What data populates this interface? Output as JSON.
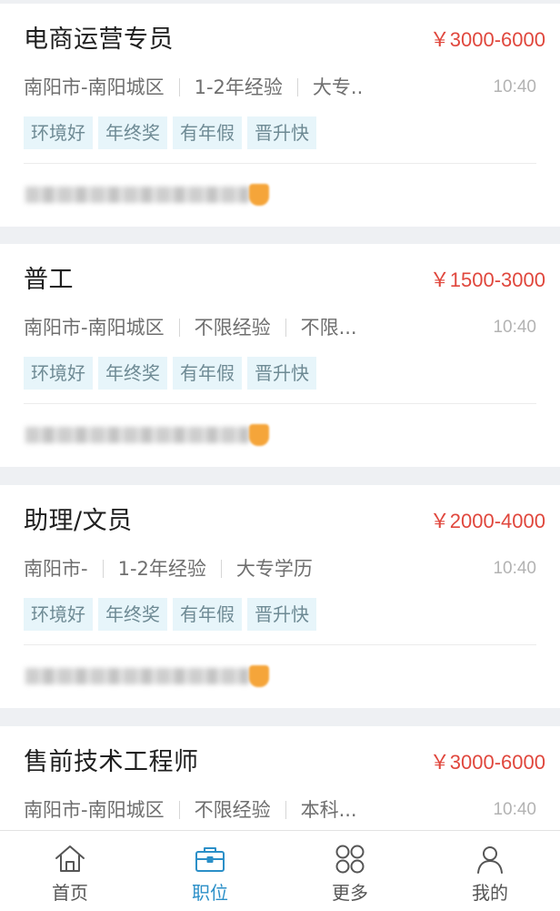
{
  "jobs": [
    {
      "title": "电商运营专员",
      "salary": "￥3000-6000",
      "location": "南阳市-南阳城区",
      "experience": "1-2年经验",
      "education": "大专..",
      "time": "10:40",
      "tags": [
        "环境好",
        "年终奖",
        "有年假",
        "晋升快"
      ]
    },
    {
      "title": "普工",
      "salary": "￥1500-3000",
      "location": "南阳市-南阳城区",
      "experience": "不限经验",
      "education": "不限...",
      "time": "10:40",
      "tags": [
        "环境好",
        "年终奖",
        "有年假",
        "晋升快"
      ]
    },
    {
      "title": "助理/文员",
      "salary": "￥2000-4000",
      "location": "南阳市-",
      "experience": "1-2年经验",
      "education": "大专学历",
      "time": "10:40",
      "tags": [
        "环境好",
        "年终奖",
        "有年假",
        "晋升快"
      ]
    },
    {
      "title": "售前技术工程师",
      "salary": "￥3000-6000",
      "location": "南阳市-南阳城区",
      "experience": "不限经验",
      "education": "本科...",
      "time": "10:40",
      "tags": []
    }
  ],
  "tab_bar": {
    "items": [
      {
        "label": "首页",
        "icon": "home-icon",
        "active": false
      },
      {
        "label": "职位",
        "icon": "briefcase-icon",
        "active": true
      },
      {
        "label": "更多",
        "icon": "grid-more-icon",
        "active": false
      },
      {
        "label": "我的",
        "icon": "person-icon",
        "active": false
      }
    ]
  },
  "colors": {
    "salary": "#e0473d",
    "active_tab": "#2b8fc8",
    "tag_bg": "#e7f5fa",
    "tag_text": "#6e8a94",
    "page_bg": "#eef0f3"
  }
}
